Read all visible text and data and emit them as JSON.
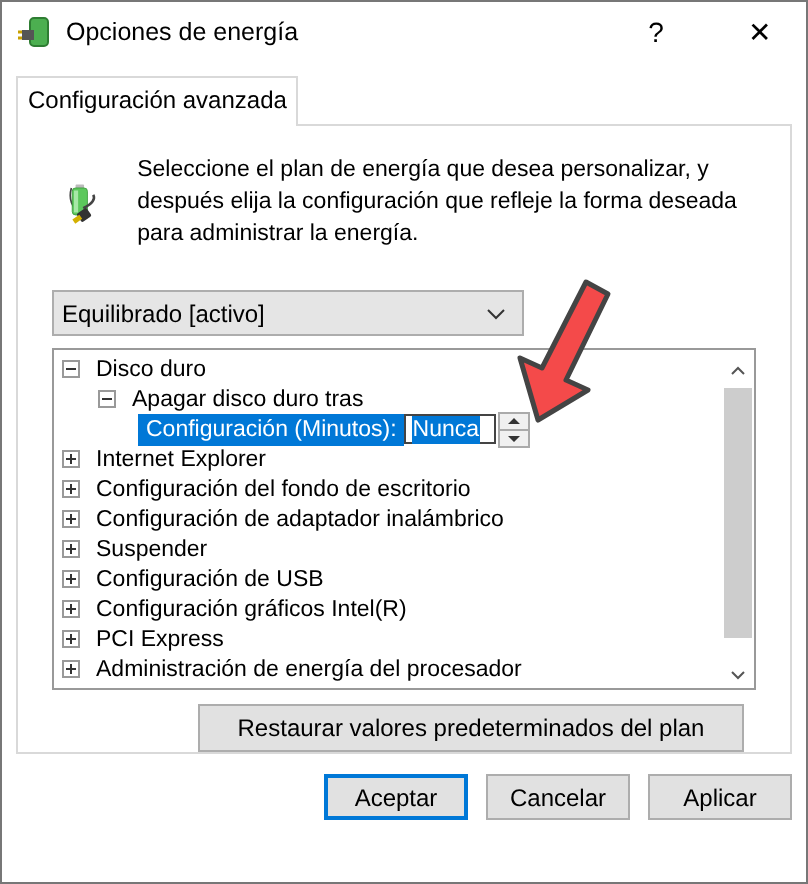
{
  "window": {
    "title": "Opciones de energía",
    "help": "?",
    "close": "✕"
  },
  "tabs": [
    {
      "label": "Configuración avanzada",
      "selected": true
    }
  ],
  "description": "Seleccione el plan de energía que desea personalizar, y después elija la configuración que refleje la forma deseada para administrar la energía.",
  "plan_dropdown": {
    "value": "Equilibrado [activo]"
  },
  "tree": [
    {
      "label": "Disco duro",
      "expanded": true,
      "children": [
        {
          "label": "Apagar disco duro tras",
          "expanded": true,
          "children": [
            {
              "kind": "setting",
              "label": "Configuración (Minutos):",
              "value": "Nunca",
              "selected": true
            }
          ]
        }
      ]
    },
    {
      "label": "Internet Explorer",
      "expanded": false
    },
    {
      "label": "Configuración del fondo de escritorio",
      "expanded": false
    },
    {
      "label": "Configuración de adaptador inalámbrico",
      "expanded": false
    },
    {
      "label": "Suspender",
      "expanded": false
    },
    {
      "label": "Configuración de USB",
      "expanded": false
    },
    {
      "label": "Configuración gráficos Intel(R)",
      "expanded": false
    },
    {
      "label": "PCI Express",
      "expanded": false
    },
    {
      "label": "Administración de energía del procesador",
      "expanded": false
    }
  ],
  "restore_button": "Restaurar valores predeterminados del plan",
  "buttons": [
    {
      "label": "Aceptar",
      "default": true
    },
    {
      "label": "Cancelar",
      "default": false
    },
    {
      "label": "Aplicar",
      "default": false
    }
  ]
}
